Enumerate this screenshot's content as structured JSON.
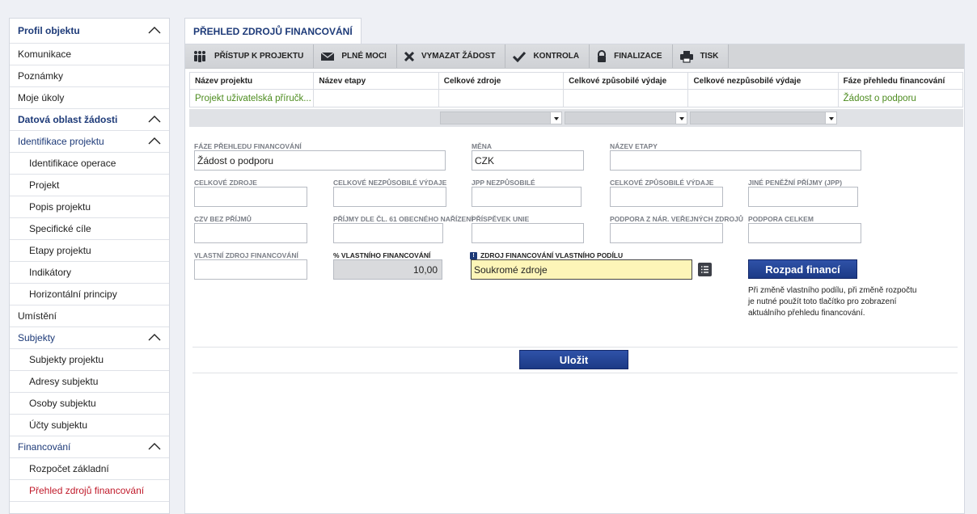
{
  "sidebar": {
    "items": [
      {
        "label": "Profil objektu",
        "type": "section",
        "chevron": true
      },
      {
        "label": "Komunikace",
        "type": "item"
      },
      {
        "label": "Poznámky",
        "type": "item"
      },
      {
        "label": "Moje úkoly",
        "type": "item"
      },
      {
        "label": "Datová oblast žádosti",
        "type": "section",
        "chevron": true
      },
      {
        "label": "Identifikace projektu",
        "type": "group",
        "chevron": true
      },
      {
        "label": "Identifikace operace",
        "type": "sub"
      },
      {
        "label": "Projekt",
        "type": "sub"
      },
      {
        "label": "Popis projektu",
        "type": "sub"
      },
      {
        "label": "Specifické cíle",
        "type": "sub"
      },
      {
        "label": "Etapy projektu",
        "type": "sub"
      },
      {
        "label": "Indikátory",
        "type": "sub"
      },
      {
        "label": "Horizontální principy",
        "type": "sub"
      },
      {
        "label": "Umístění",
        "type": "item"
      },
      {
        "label": "Subjekty",
        "type": "group",
        "chevron": true
      },
      {
        "label": "Subjekty projektu",
        "type": "sub"
      },
      {
        "label": "Adresy subjektu",
        "type": "sub"
      },
      {
        "label": "Osoby subjektu",
        "type": "sub"
      },
      {
        "label": "Účty subjektu",
        "type": "sub"
      },
      {
        "label": "Financování",
        "type": "group",
        "chevron": true
      },
      {
        "label": "Rozpočet základní",
        "type": "sub"
      },
      {
        "label": "Přehled zdrojů financování",
        "type": "sub",
        "active": true
      }
    ]
  },
  "tab": {
    "label": "PŘEHLED ZDROJŮ FINANCOVÁNÍ"
  },
  "toolbar": {
    "items": [
      {
        "label": "PŘÍSTUP K PROJEKTU",
        "icon": "people-icon"
      },
      {
        "label": "PLNÉ MOCI",
        "icon": "envelope-icon"
      },
      {
        "label": "VYMAZAT ŽÁDOST",
        "icon": "x-icon"
      },
      {
        "label": "KONTROLA",
        "icon": "check-icon"
      },
      {
        "label": "FINALIZACE",
        "icon": "lock-icon"
      },
      {
        "label": "TISK",
        "icon": "printer-icon"
      }
    ]
  },
  "grid": {
    "columns": [
      "Název projektu",
      "Název etapy",
      "Celkové zdroje",
      "Celkové způsobilé výdaje",
      "Celkové nezpůsobilé výdaje",
      "Fáze přehledu financování"
    ],
    "row": [
      "Projekt uživatelská příručk...",
      "",
      "",
      "",
      "",
      "Žádost o podporu"
    ]
  },
  "form": {
    "faze_label": "FÁZE PŘEHLEDU FINANCOVÁNÍ",
    "faze_value": "Žádost o podporu",
    "mena_label": "MĚNA",
    "mena_value": "CZK",
    "etapa_label": "NÁZEV ETAPY",
    "etapa_value": "",
    "zdroje_label": "CELKOVÉ ZDROJE",
    "nezpus_label": "CELKOVÉ NEZPŮSOBILÉ VÝDAJE",
    "jpp_label": "JPP NEZPŮSOBILÉ",
    "zpus_label": "CELKOVÉ ZPŮSOBILÉ VÝDAJE",
    "jine_label": "JINÉ PENĚŽNÍ PŘÍJMY (JPP)",
    "czv_label": "CZV BEZ PŘÍJMŮ",
    "prijmy_label": "PŘÍJMY DLE ČL. 61 OBECNÉHO NAŘÍZENÍ",
    "prispevek_label": "PŘÍSPĚVEK UNIE",
    "podpora_nar_label": "PODPORA Z NÁR. VEŘEJNÝCH ZDROJŮ",
    "podpora_celkem_label": "PODPORA CELKEM",
    "vlastni_label": "VLASTNÍ ZDROJ FINANCOVÁNÍ",
    "pct_label": "% VLASTNÍHO FINANCOVÁNÍ",
    "pct_value": "10,00",
    "zdroj_label": "ZDROJ FINANCOVÁNÍ VLASTNÍHO PODÍLU",
    "zdroj_value": "Soukromé zdroje",
    "rozpad_button": "Rozpad financí",
    "note": "Při změně vlastního podílu, při změně rozpočtu je nutné použít toto tlačítko pro zobrazení aktuálního přehledu financování.",
    "save_button": "Uložit"
  }
}
